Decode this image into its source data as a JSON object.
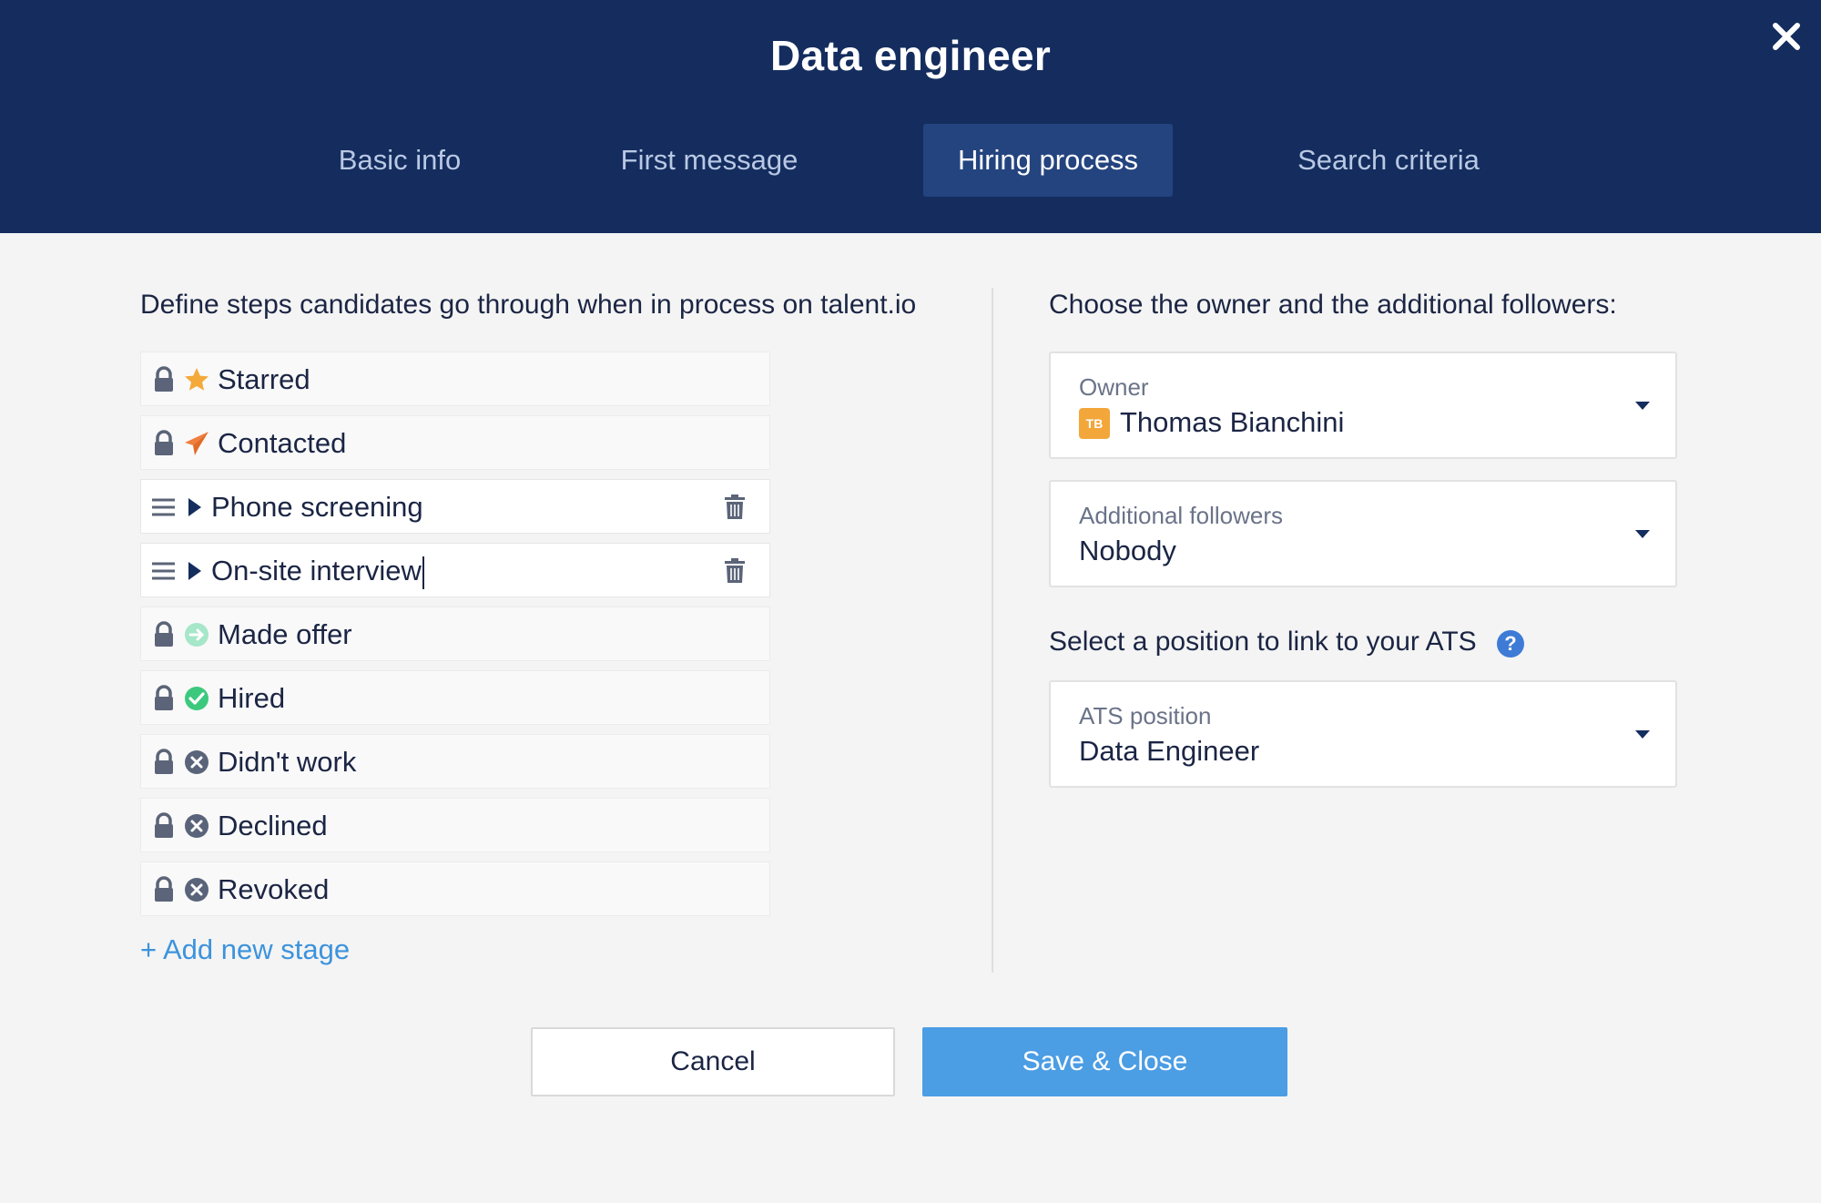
{
  "modal": {
    "title": "Data engineer"
  },
  "tabs": [
    {
      "label": "Basic info",
      "active": false
    },
    {
      "label": "First message",
      "active": false
    },
    {
      "label": "Hiring process",
      "active": true
    },
    {
      "label": "Search criteria",
      "active": false
    }
  ],
  "left": {
    "heading": "Define steps candidates go through when in process on talent.io",
    "stages": [
      {
        "label": "Starred",
        "locked": true,
        "icon": "star-icon"
      },
      {
        "label": "Contacted",
        "locked": true,
        "icon": "paper-plane-icon"
      },
      {
        "label": "Phone screening",
        "locked": false,
        "icon": "play-icon"
      },
      {
        "label": "On-site interview",
        "locked": false,
        "icon": "play-icon"
      },
      {
        "label": "Made offer",
        "locked": true,
        "icon": "arrow-circle-icon"
      },
      {
        "label": "Hired",
        "locked": true,
        "icon": "check-circle-icon"
      },
      {
        "label": "Didn't work",
        "locked": true,
        "icon": "x-circle-icon"
      },
      {
        "label": "Declined",
        "locked": true,
        "icon": "x-circle-icon"
      },
      {
        "label": "Revoked",
        "locked": true,
        "icon": "x-circle-icon"
      }
    ],
    "add_stage": "+ Add new stage"
  },
  "right": {
    "heading": "Choose the owner and the additional followers:",
    "owner": {
      "label": "Owner",
      "avatar_initials": "TB",
      "value": "Thomas Bianchini"
    },
    "followers": {
      "label": "Additional followers",
      "value": "Nobody"
    },
    "ats_heading": "Select a position to link to your ATS",
    "ats": {
      "label": "ATS position",
      "value": "Data Engineer"
    }
  },
  "footer": {
    "cancel": "Cancel",
    "save": "Save & Close"
  },
  "colors": {
    "header_bg": "#142d5e",
    "active_tab_bg": "#24447f",
    "accent": "#4b9de4",
    "star": "#f4a93b",
    "contacted": "#f07f3c",
    "made_offer": "#a6e6c9",
    "hired": "#3cc97e",
    "rejected": "#59647a"
  }
}
